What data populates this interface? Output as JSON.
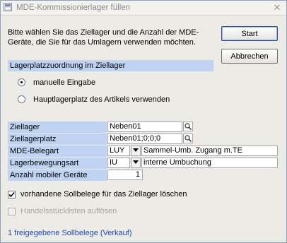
{
  "window": {
    "title": "MDE-Kommissionierlager füllen",
    "close_symbol": "✕"
  },
  "instruction": "Bitte wählen Sie das Ziellager und die Anzahl der MDE-Geräte, die Sie für das Umlagern verwenden möchten.",
  "buttons": {
    "start": "Start",
    "cancel": "Abbrechen"
  },
  "assignment": {
    "header": "Lagerplatzzuordnung im Ziellager",
    "options": [
      {
        "label": "manuelle Eingabe",
        "selected": true
      },
      {
        "label": "Hauptlagerplatz des Artikels verwenden",
        "selected": false
      }
    ]
  },
  "form": {
    "ziellager": {
      "label": "Ziellager",
      "value": "Neben01"
    },
    "ziellagerplatz": {
      "label": "Ziellagerplatz",
      "value": "Neben01;0;0;0"
    },
    "belegart": {
      "label": "MDE-Belegart",
      "code": "LUY",
      "description": "Sammel-Umb. Zugang m.TE"
    },
    "bewegungsart": {
      "label": "Lagerbewegungsart",
      "code": "IU",
      "description": "interne Umbuchung"
    },
    "anzahl": {
      "label": "Anzahl mobiler Geräte",
      "value": "1"
    }
  },
  "checks": {
    "delete_sollbelege": {
      "label": "vorhandene Sollbelege für das Ziellager löschen",
      "checked": true,
      "enabled": true
    },
    "resolve_lists": {
      "label": "Handelsstücklisten auflösen",
      "checked": false,
      "enabled": false
    }
  },
  "status": "1 freigegebene Sollbelege (Verkauf)",
  "colors": {
    "label_bg": "#bfd4f2",
    "window_bg": "#ecebe6",
    "status_text": "#1f4bb5"
  }
}
